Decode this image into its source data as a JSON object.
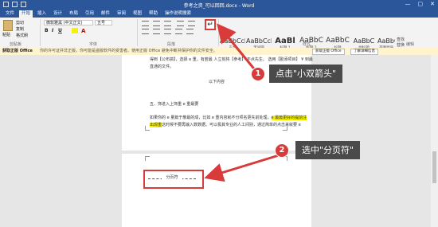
{
  "window": {
    "title": "参考之资_可以回回.docx - Word",
    "min": "—",
    "max": "▢",
    "close": "✕"
  },
  "tabs": [
    "文件",
    "开始",
    "插入",
    "设计",
    "布局",
    "引用",
    "邮件",
    "审阅",
    "视图",
    "帮助",
    "操作说明搜索"
  ],
  "ribbon": {
    "paste_label": "粘贴",
    "cut": "剪切",
    "copy": "复制",
    "format_painter": "格式刷",
    "clipboard_group": "剪贴板",
    "font_name": "微软雅黑 (中文正文)",
    "font_size": "五号",
    "font_group": "字体",
    "paragraph_group": "段落",
    "styles_group": "样式",
    "show_marks_icon": "↵",
    "styles": [
      {
        "sample": "AaBbCcDc",
        "name": "正文"
      },
      {
        "sample": "AaBbCcDc",
        "name": "无间隔"
      },
      {
        "sample": "AaBl",
        "name": "标题 1"
      },
      {
        "sample": "AaBbC",
        "name": "标题 2"
      },
      {
        "sample": "AaBbC",
        "name": "标题"
      },
      {
        "sample": "AaBbC",
        "name": "副标题"
      },
      {
        "sample": "AaBbCcDc",
        "name": "不明显强调"
      }
    ],
    "editing": {
      "find": "查找",
      "replace": "替换",
      "select": "选择",
      "group": "编辑"
    }
  },
  "infobar": {
    "title": "获取正版 Office",
    "message": "你的许可证并非正版，你可能是盗版软件的受害者。使用正版 Office 避免中断并保护你的文件安全。",
    "btn_primary": "获取正版 Office",
    "btn_secondary": "了解详细信息"
  },
  "document": {
    "line1": "得到【公布搞】，选择 e 重，有若最 人立刻将【参考】 不点先生。 选用【勤添项目】 ¥ 到最",
    "line2": "直通的文件。",
    "center_text": "以下内容",
    "heading": "五、饰进入上饰重 e 重最要",
    "body1": "如果你的 e 量篇于散最的成，比如 e 重内容就不分项名更先前处理，",
    "body1_hl": "e 最篇更好的提前注",
    "body2_hl": "出现重",
    "body2": "这时候不要再输入数数据。可以极其专业的人工间别，通过简单的点击来就要 e",
    "page_break_label": "分页符"
  },
  "callouts": {
    "step1": {
      "num": "1",
      "text": "点击\"小双箭头\""
    },
    "step2": {
      "num": "2",
      "text": "选中\"分页符\""
    }
  },
  "colors": {
    "accent": "#2b579a",
    "highlight_box": "#d63c3c",
    "marker": "#d93a3a",
    "callout_bg": "#4a4a4a",
    "text_highlight": "#f7f300"
  }
}
